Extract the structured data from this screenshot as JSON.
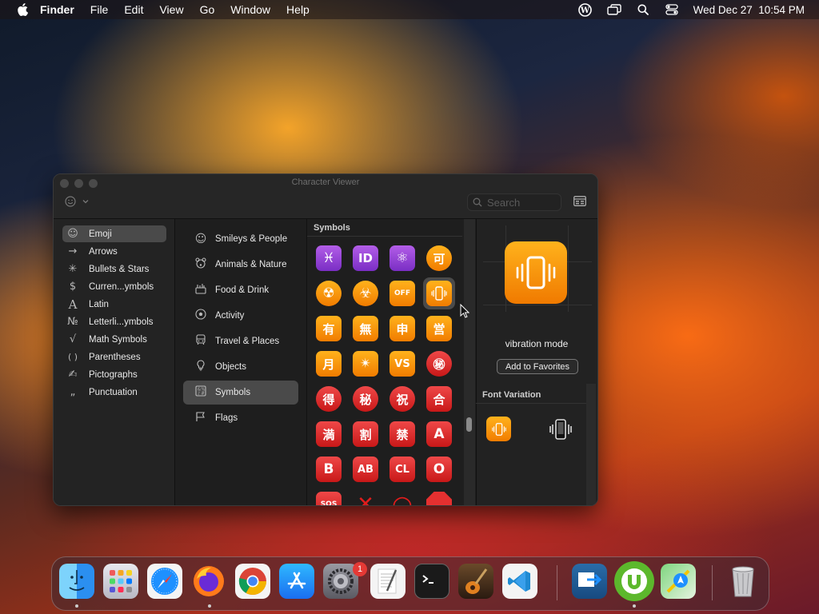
{
  "menubar": {
    "app": "Finder",
    "items": [
      "File",
      "Edit",
      "View",
      "Go",
      "Window",
      "Help"
    ],
    "clock": "Wed Dec 27  10:54 PM"
  },
  "window": {
    "title": "Character Viewer",
    "search_placeholder": "Search",
    "sidebar": [
      {
        "label": "Emoji",
        "icon": "smiley-icon",
        "glyph": "☺",
        "selected": true
      },
      {
        "label": "Arrows",
        "icon": "arrow-icon",
        "glyph": "→"
      },
      {
        "label": "Bullets & Stars",
        "icon": "star-icon",
        "glyph": "✳"
      },
      {
        "label": "Curren...ymbols",
        "icon": "dollar-icon",
        "glyph": "$"
      },
      {
        "label": "Latin",
        "icon": "latin-a-icon",
        "glyph": "A"
      },
      {
        "label": "Letterli...ymbols",
        "icon": "numero-icon",
        "glyph": "№"
      },
      {
        "label": "Math Symbols",
        "icon": "sqrt-icon",
        "glyph": "√"
      },
      {
        "label": "Parentheses",
        "icon": "parentheses-icon",
        "glyph": "( )"
      },
      {
        "label": "Pictographs",
        "icon": "pictograph-icon",
        "glyph": "✍"
      },
      {
        "label": "Punctuation",
        "icon": "punctuation-icon",
        "glyph": "„"
      }
    ],
    "categories": [
      {
        "label": "Smileys & People",
        "icon": "smiley-icon",
        "glyph": "☺"
      },
      {
        "label": "Animals & Nature",
        "icon": "bear-icon",
        "glyph": "🐾"
      },
      {
        "label": "Food & Drink",
        "icon": "food-icon",
        "glyph": "🍴"
      },
      {
        "label": "Activity",
        "icon": "ball-icon",
        "glyph": "⚽"
      },
      {
        "label": "Travel & Places",
        "icon": "bus-icon",
        "glyph": "🚌"
      },
      {
        "label": "Objects",
        "icon": "bulb-icon",
        "glyph": "💡"
      },
      {
        "label": "Symbols",
        "icon": "symbols-icon",
        "glyph": "⚿",
        "selected": true
      },
      {
        "label": "Flags",
        "icon": "flag-icon",
        "glyph": "⚐"
      }
    ],
    "grid_heading": "Symbols",
    "symbols": [
      [
        "♓",
        "ID",
        "⚛",
        "可"
      ],
      [
        "☢",
        "☣",
        "OFF",
        "📳"
      ],
      [
        "有",
        "無",
        "申",
        "営"
      ],
      [
        "月",
        "✴",
        "VS",
        "㊙"
      ],
      [
        "得",
        "秘",
        "祝",
        "合"
      ],
      [
        "満",
        "割",
        "禁",
        "A"
      ],
      [
        "B",
        "AB",
        "CL",
        "O"
      ],
      [
        "SOS",
        "✕",
        "○",
        "🛑"
      ]
    ],
    "detail": {
      "name": "vibration mode",
      "favorites_button": "Add to Favorites",
      "font_variation_heading": "Font Variation"
    }
  },
  "dock": {
    "apps": [
      "Finder",
      "Launchpad",
      "Safari",
      "Firefox",
      "Chrome",
      "App Store",
      "System Settings",
      "TextEdit",
      "Terminal",
      "GarageBand",
      "Visual Studio Code",
      "Migration Assistant",
      "uTorrent",
      "Maps",
      "Trash"
    ],
    "settings_badge": "1"
  }
}
